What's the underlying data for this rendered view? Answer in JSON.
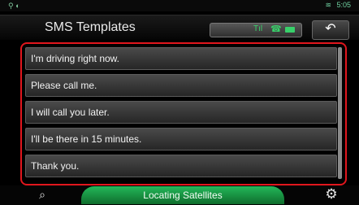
{
  "status_bar": {
    "left_icons": "⚲ ◐",
    "wifi_icon": "wifi-icon",
    "time": "5:05"
  },
  "header": {
    "title": "SMS Templates",
    "signal_icon": "signal-icon",
    "handset_icon": "handset-icon",
    "battery_icon": "battery-icon",
    "back_icon": "back-arrow-icon"
  },
  "templates": [
    "I'm driving right now.",
    "Please call me.",
    "I will call you later.",
    "I'll be there in 15 minutes.",
    "Thank you."
  ],
  "bottom_bar": {
    "search_icon": "search-icon",
    "status_text": "Locating Satellites",
    "settings_icon": "gear-icon"
  },
  "colors": {
    "highlight": "#e0161d",
    "accent_green": "#23b85a"
  }
}
